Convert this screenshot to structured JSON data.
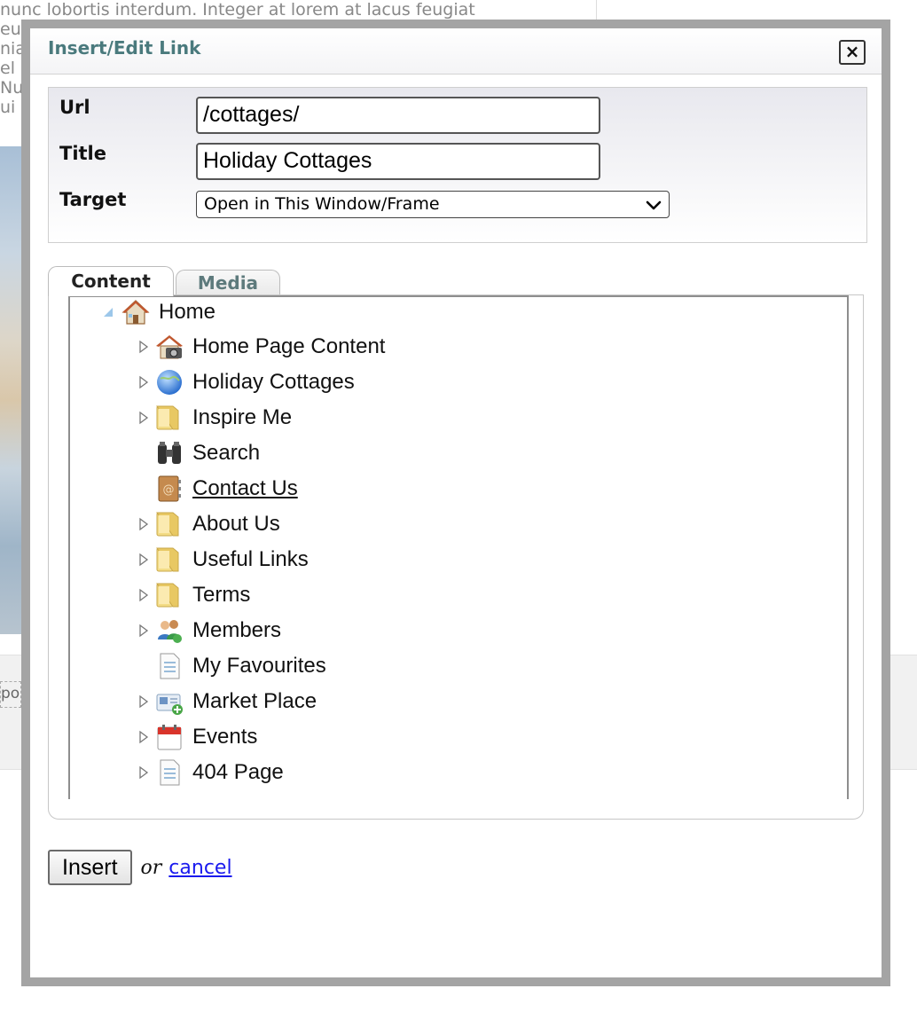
{
  "background": {
    "text_lines": [
      "nunc lobortis interdum. Integer at lorem at lacus feugiat",
      "euis",
      "nia",
      "  el",
      " Nu",
      "ui"
    ],
    "strip_text": "pos"
  },
  "dialog": {
    "title": "Insert/Edit Link",
    "close_label": "×"
  },
  "fields": {
    "url_label": "Url",
    "url_value": "/cottages/",
    "title_label": "Title",
    "title_value": "Holiday Cottages",
    "target_label": "Target",
    "target_selected": "Open in This Window/Frame"
  },
  "tabs": [
    {
      "label": "Content",
      "active": true
    },
    {
      "label": "Media",
      "active": false
    }
  ],
  "tree": {
    "root": {
      "label": "Home",
      "icon": "house-icon"
    },
    "items": [
      {
        "label": "Home Page Content",
        "icon": "house-camera-icon",
        "expandable": true
      },
      {
        "label": "Holiday Cottages",
        "icon": "globe-icon",
        "expandable": true
      },
      {
        "label": "Inspire Me",
        "icon": "folder-icon",
        "expandable": true
      },
      {
        "label": "Search",
        "icon": "binoculars-icon",
        "expandable": false
      },
      {
        "label": "Contact Us",
        "icon": "address-book-icon",
        "expandable": false,
        "link": true
      },
      {
        "label": "About Us",
        "icon": "folder-icon",
        "expandable": true
      },
      {
        "label": "Useful Links",
        "icon": "folder-icon",
        "expandable": true
      },
      {
        "label": "Terms",
        "icon": "folder-icon",
        "expandable": true
      },
      {
        "label": "Members",
        "icon": "members-icon",
        "expandable": true
      },
      {
        "label": "My Favourites",
        "icon": "document-icon",
        "expandable": false
      },
      {
        "label": "Market Place",
        "icon": "marketplace-icon",
        "expandable": true
      },
      {
        "label": "Events",
        "icon": "calendar-icon",
        "expandable": true
      },
      {
        "label": "404 Page",
        "icon": "document-icon",
        "expandable": true
      }
    ]
  },
  "actions": {
    "insert_label": "Insert",
    "or_text": "or",
    "cancel_label": "cancel"
  },
  "colors": {
    "title": "#4a7a7d",
    "link": "#1a1aee",
    "frame": "#a4a4a4"
  }
}
